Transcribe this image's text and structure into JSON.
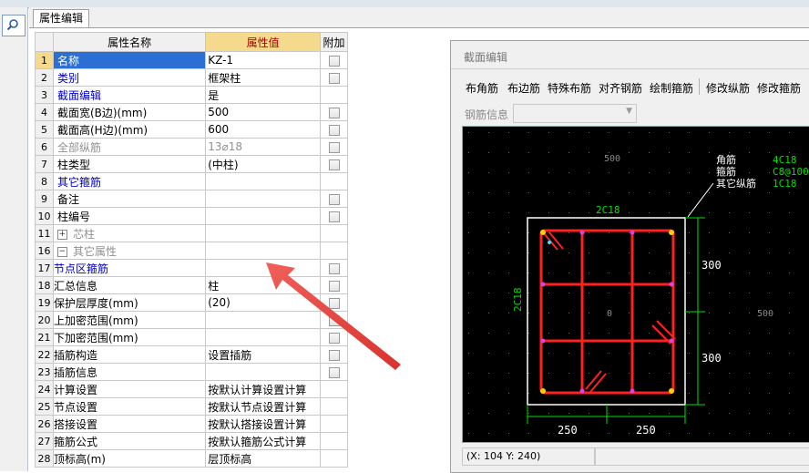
{
  "tab": "属性编辑",
  "headers": {
    "col_name": "属性名称",
    "col_value": "属性值",
    "col_extra": "附加"
  },
  "rows": [
    {
      "n": "1",
      "name": "名称",
      "value": "KZ-1"
    },
    {
      "n": "2",
      "name": "类别",
      "value": "框架柱"
    },
    {
      "n": "3",
      "name": "截面编辑",
      "value": "是"
    },
    {
      "n": "4",
      "name": "截面宽(B边)(mm)",
      "value": "500"
    },
    {
      "n": "5",
      "name": "截面高(H边)(mm)",
      "value": "600"
    },
    {
      "n": "6",
      "name": "全部纵筋",
      "value": "13⌀18"
    },
    {
      "n": "7",
      "name": "柱类型",
      "value": "(中柱)"
    },
    {
      "n": "8",
      "name": "其它箍筋",
      "value": ""
    },
    {
      "n": "9",
      "name": "备注",
      "value": ""
    },
    {
      "n": "10",
      "name": "柱编号",
      "value": ""
    },
    {
      "n": "11",
      "name": "芯柱",
      "value": ""
    },
    {
      "n": "16",
      "name": "其它属性",
      "value": ""
    },
    {
      "n": "17",
      "name": "节点区箍筋",
      "value": ""
    },
    {
      "n": "18",
      "name": "汇总信息",
      "value": "柱"
    },
    {
      "n": "19",
      "name": "保护层厚度(mm)",
      "value": "(20)"
    },
    {
      "n": "20",
      "name": "上加密范围(mm)",
      "value": ""
    },
    {
      "n": "21",
      "name": "下加密范围(mm)",
      "value": ""
    },
    {
      "n": "22",
      "name": "插筋构造",
      "value": "设置插筋"
    },
    {
      "n": "23",
      "name": "插筋信息",
      "value": ""
    },
    {
      "n": "24",
      "name": "计算设置",
      "value": "按默认计算设置计算"
    },
    {
      "n": "25",
      "name": "节点设置",
      "value": "按默认节点设置计算"
    },
    {
      "n": "26",
      "name": "搭接设置",
      "value": "按默认搭接设置计算"
    },
    {
      "n": "27",
      "name": "箍筋公式",
      "value": "按默认箍筋公式计算"
    },
    {
      "n": "28",
      "name": "顶标高(m)",
      "value": "层顶标高"
    }
  ],
  "dialog": {
    "title": "截面编辑",
    "toolbar": [
      "布角筋",
      "布边筋",
      "特殊布筋",
      "对齐钢筋",
      "绘制箍筋",
      "修改纵筋",
      "修改箍筋"
    ],
    "rebar_info_label": "钢筋信息",
    "canvas": {
      "grid_labels": [
        "500",
        "500",
        "0"
      ],
      "legend_names": [
        "角筋",
        "箍筋",
        "其它纵筋"
      ],
      "legend_values": [
        "4C18",
        "C8@100",
        "1C18"
      ],
      "top_rebar": "2C18",
      "left_rebar": "2C18",
      "dim_right": [
        "300",
        "300"
      ],
      "dim_bottom": [
        "250",
        "250"
      ]
    },
    "coords": "(X: 104 Y: 240)"
  },
  "colors": {
    "rebar": "#ff2020",
    "dimension": "#00e000",
    "text": "#ffffff",
    "highlight": "#f5d98c",
    "selection": "#2c6fd4",
    "arrow": "#e8443e"
  }
}
